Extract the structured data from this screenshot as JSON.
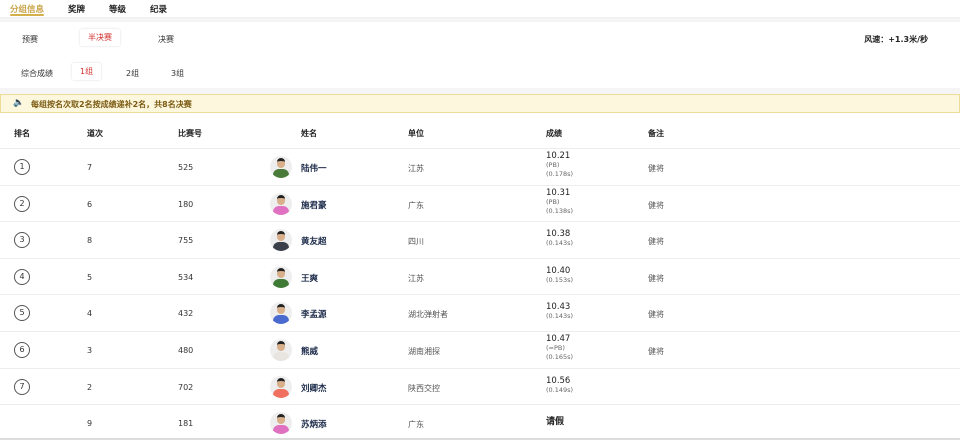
{
  "top_tabs": [
    "分组信息",
    "奖牌",
    "等级",
    "纪录"
  ],
  "round_tabs": [
    "预赛",
    "半决赛",
    "决赛"
  ],
  "wind": "风速：+1.3米/秒",
  "group_tabs": [
    "综合成绩",
    "1组",
    "2组",
    "3组"
  ],
  "notice": "每组按名次取2名按成绩递补2名，共8名决赛",
  "headers": [
    "排名",
    "道次",
    "比赛号",
    "姓名",
    "单位",
    "成绩",
    "备注"
  ],
  "rows": [
    {
      "rank": "1",
      "lane": "7",
      "bib": "525",
      "name": "陆伟一",
      "unit": "江苏",
      "mark": "10.21",
      "tag": "(PB)",
      "reaction": "(0.178s)",
      "note": "健将",
      "kit": "#4a7a3a"
    },
    {
      "rank": "2",
      "lane": "6",
      "bib": "180",
      "name": "施君豪",
      "unit": "广东",
      "mark": "10.31",
      "tag": "(PB)",
      "reaction": "(0.138s)",
      "note": "健将",
      "kit": "#e070c0"
    },
    {
      "rank": "3",
      "lane": "8",
      "bib": "755",
      "name": "黄友超",
      "unit": "四川",
      "mark": "10.38",
      "tag": "",
      "reaction": "(0.143s)",
      "note": "健将",
      "kit": "#3a3f4a"
    },
    {
      "rank": "4",
      "lane": "5",
      "bib": "534",
      "name": "王爽",
      "unit": "江苏",
      "mark": "10.40",
      "tag": "",
      "reaction": "(0.153s)",
      "note": "健将",
      "kit": "#3f7a35"
    },
    {
      "rank": "5",
      "lane": "4",
      "bib": "432",
      "name": "李孟源",
      "unit": "湖北弹射者",
      "mark": "10.43",
      "tag": "",
      "reaction": "(0.143s)",
      "note": "健将",
      "kit": "#4a6ad0"
    },
    {
      "rank": "6",
      "lane": "3",
      "bib": "480",
      "name": "熊威",
      "unit": "湖南湘探",
      "mark": "10.47",
      "tag": "(=PB)",
      "reaction": "(0.165s)",
      "note": "健将",
      "kit": "#e8e4e0"
    },
    {
      "rank": "7",
      "lane": "2",
      "bib": "702",
      "name": "刘卿杰",
      "unit": "陕西交控",
      "mark": "10.56",
      "tag": "",
      "reaction": "(0.149s)",
      "note": "",
      "kit": "#f07060"
    },
    {
      "rank": "",
      "lane": "9",
      "bib": "181",
      "name": "苏炳添",
      "unit": "广东",
      "mark": "",
      "tag": "",
      "reaction": "",
      "note": "",
      "status": "请假",
      "kit": "#e070c0"
    }
  ]
}
